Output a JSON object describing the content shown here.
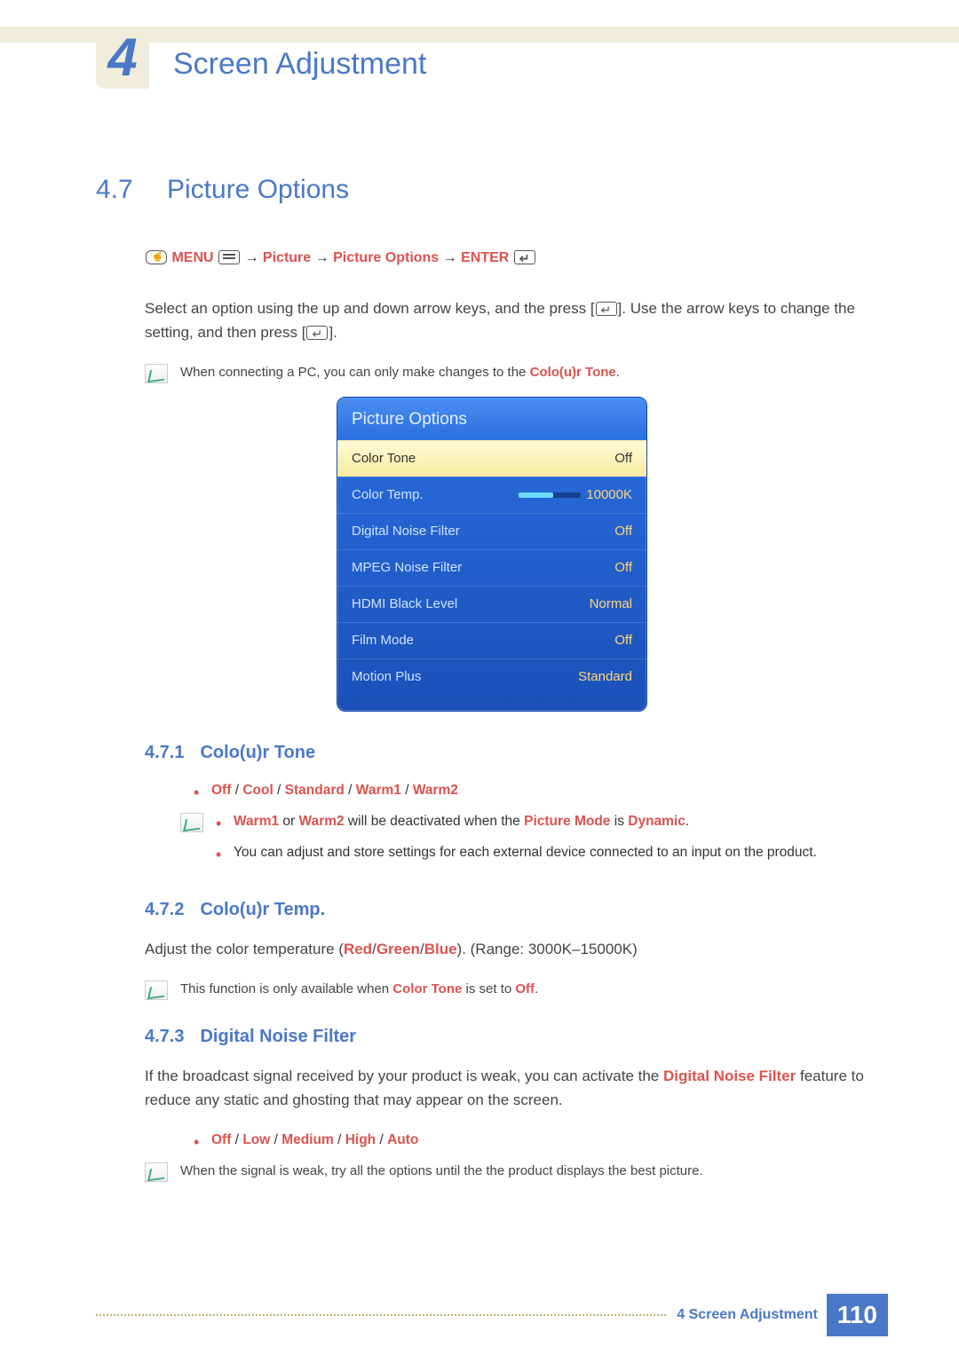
{
  "chapter": {
    "num": "4",
    "title": "Screen Adjustment"
  },
  "section": {
    "num": "4.7",
    "title": "Picture Options"
  },
  "nav_path": {
    "menu": "MENU",
    "p1": "Picture",
    "p2": "Picture Options",
    "enter": "ENTER"
  },
  "intro_a": "Select an option using the up and down arrow keys, and the press [",
  "intro_b": "]. Use the arrow keys to change the setting, and then press [",
  "intro_c": "].",
  "note_pc_a": "When connecting a PC, you can only make changes to the ",
  "note_pc_hl": "Colo(u)r Tone",
  "note_pc_b": ".",
  "osd": {
    "title": "Picture Options",
    "rows": [
      {
        "label": "Color Tone",
        "value": "Off",
        "selected": true
      },
      {
        "label": "Color Temp.",
        "value": "10000K",
        "slider": true
      },
      {
        "label": "Digital Noise Filter",
        "value": "Off"
      },
      {
        "label": "MPEG Noise Filter",
        "value": "Off"
      },
      {
        "label": "HDMI Black Level",
        "value": "Normal"
      },
      {
        "label": "Film Mode",
        "value": "Off"
      },
      {
        "label": "Motion Plus",
        "value": "Standard"
      }
    ]
  },
  "s471": {
    "num": "4.7.1",
    "title": "Colo(u)r Tone",
    "opts": {
      "o1": "Off",
      "o2": "Cool",
      "o3": "Standard",
      "o4": "Warm1",
      "o5": "Warm2"
    },
    "n1a": "Warm1",
    "n1b": " or ",
    "n1c": "Warm2",
    "n1d": " will be deactivated when the ",
    "n1e": "Picture Mode",
    "n1f": " is ",
    "n1g": "Dynamic",
    "n1h": ".",
    "n2": "You can adjust and store settings for each external device connected to an input on the product."
  },
  "s472": {
    "num": "4.7.2",
    "title": "Colo(u)r Temp.",
    "p_a": "Adjust the color temperature (",
    "red": "Red",
    "green": "Green",
    "blue": "Blue",
    "p_b": "). (Range: 3000K–15000K)",
    "note_a": "This function is only available when ",
    "note_hl": "Color Tone",
    "note_b": " is set to ",
    "note_hl2": "Off",
    "note_c": "."
  },
  "s473": {
    "num": "4.7.3",
    "title": "Digital Noise Filter",
    "p_a": "If the broadcast signal received by your product is weak, you can activate the ",
    "p_hl": "Digital Noise Filter",
    "p_b": " feature to reduce any static and ghosting that may appear on the screen.",
    "opts": {
      "o1": "Off",
      "o2": "Low",
      "o3": "Medium",
      "o4": "High",
      "o5": "Auto"
    },
    "note": "When the signal is weak, try all the options until the the product displays the best picture."
  },
  "footer": {
    "chapter_ref": "4",
    "label": "Screen Adjustment",
    "page": "110"
  }
}
